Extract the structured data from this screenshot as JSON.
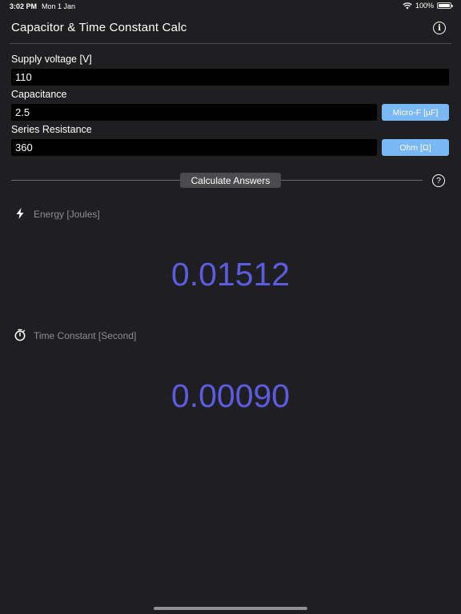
{
  "status_bar": {
    "time": "3:02 PM",
    "date": "Mon 1 Jan",
    "battery": "100%"
  },
  "header": {
    "title": "Capacitor & Time Constant Calc"
  },
  "form": {
    "supply_voltage": {
      "label": "Supply voltage [V]",
      "value": "110"
    },
    "capacitance": {
      "label": "Capacitance",
      "value": "2.5",
      "unit": "Micro-F [µF]"
    },
    "resistance": {
      "label": "Series Resistance",
      "value": "360",
      "unit": "Ohm [Ω]"
    }
  },
  "actions": {
    "calculate_label": "Calculate Answers",
    "help_symbol": "?"
  },
  "results": {
    "energy": {
      "label": "Energy [Joules]",
      "value": "0.01512"
    },
    "time_constant": {
      "label": "Time Constant [Second]",
      "value": "0.00090"
    }
  },
  "colors": {
    "background": "#1f1f21",
    "accent": "#5b5ce2",
    "unit_button": "#7ab7f5"
  }
}
